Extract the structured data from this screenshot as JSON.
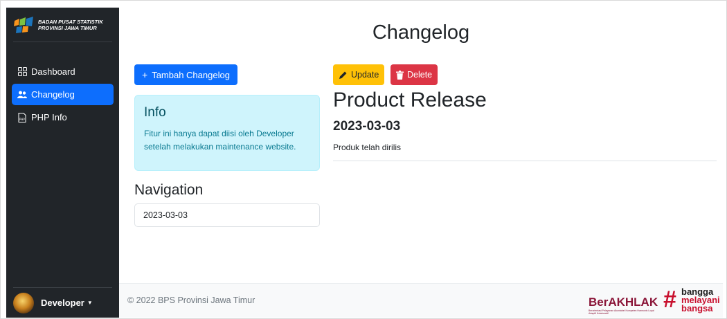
{
  "sidebar": {
    "brand": {
      "line1": "BADAN PUSAT STATISTIK",
      "line2": "PROVINSI JAWA TIMUR"
    },
    "items": [
      {
        "label": "Dashboard",
        "icon": "grid-icon",
        "active": false
      },
      {
        "label": "Changelog",
        "icon": "people-icon",
        "active": true
      },
      {
        "label": "PHP Info",
        "icon": "file-code-icon",
        "active": false
      }
    ],
    "user": {
      "name": "Developer",
      "icon": "caret-down-icon"
    }
  },
  "main": {
    "title": "Changelog",
    "add_button": "Tambah Changelog",
    "info": {
      "title": "Info",
      "body": "Fitur ini hanya dapat diisi oleh Developer setelah melakukan maintenance website."
    },
    "navigation": {
      "heading": "Navigation",
      "items": [
        "2023-03-03"
      ]
    },
    "entry": {
      "update_label": "Update",
      "delete_label": "Delete",
      "title": "Product Release",
      "date": "2023-03-03",
      "description": "Produk telah dirilis"
    }
  },
  "footer": {
    "copyright": "© 2022 BPS Provinsi Jawa Timur",
    "logo1": {
      "word": "BerAKHLAK",
      "tagline": "Berorientasi Pelayanan Akuntabel Kompeten Harmonis Loyal Adaptif Kolaboratif"
    },
    "logo2": {
      "hash": "#",
      "w1": "bangga",
      "w2": "melayani",
      "w3": "bangsa"
    }
  },
  "colors": {
    "sidebar_bg": "#212529",
    "primary": "#0d6efd",
    "warning": "#ffc107",
    "danger": "#dc3545",
    "info_bg": "#cff4fc"
  }
}
